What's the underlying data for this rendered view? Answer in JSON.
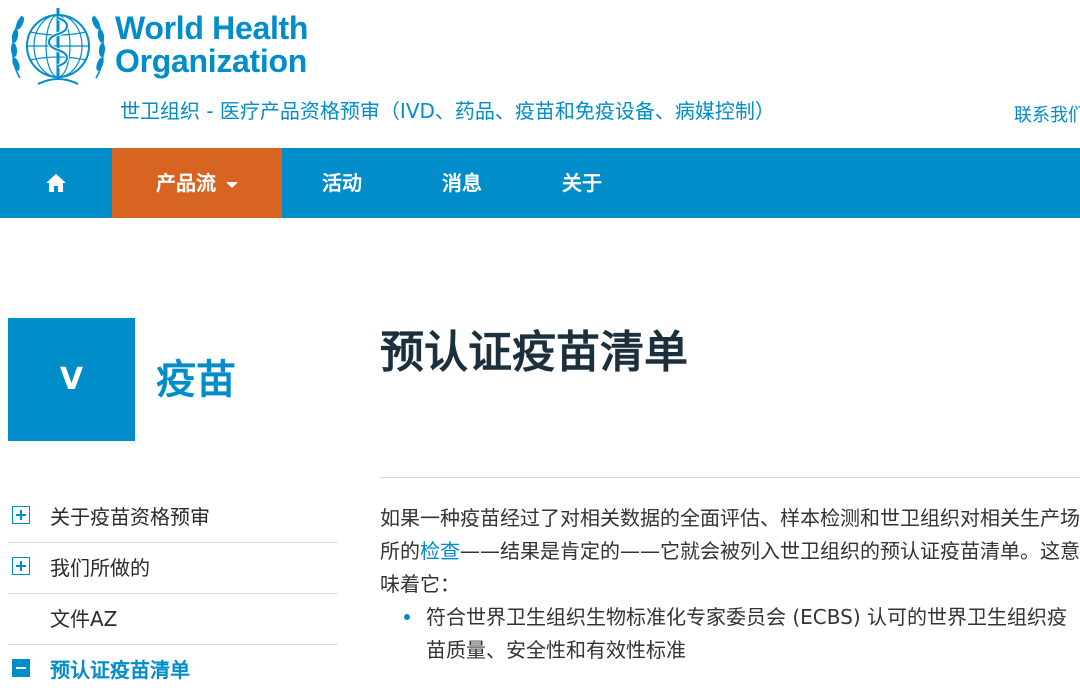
{
  "header": {
    "org_name_line1": "World Health",
    "org_name_line2": "Organization",
    "subtitle": "世卫组织 - 医疗产品资格预审（IVD、药品、疫苗和免疫设备、病媒控制）",
    "contact": "联系我们",
    "logo_icon": "who-emblem-icon",
    "brand_color": "#008dc9"
  },
  "nav": {
    "home_icon": "home-icon",
    "items": [
      "产品流",
      "活动",
      "消息",
      "关于"
    ],
    "active_color": "#d86422"
  },
  "section": {
    "letter": "V",
    "title": "疫苗"
  },
  "sidebar": {
    "items": [
      {
        "label": "关于疫苗资格预审",
        "icon": "plus-icon"
      },
      {
        "label": "我们所做的",
        "icon": "plus-icon"
      },
      {
        "label": "文件AZ",
        "icon": ""
      },
      {
        "label": "预认证疫苗清单",
        "icon": "minus-icon"
      }
    ]
  },
  "main": {
    "title": "预认证疫苗清单",
    "intro_before": "如果一种疫苗经过了对相关数据的全面评估、样本检测和世卫组织对相关生产场所的",
    "intro_link": "检查",
    "intro_after": "——结果是肯定的——它就会被列入世卫组织的预认证疫苗清单。这意味着它：",
    "bullets": [
      "符合世界卫生组织生物标准化专家委员会 (ECBS) 认可的世界卫生组织疫苗质量、安全性和有效性标准"
    ]
  }
}
